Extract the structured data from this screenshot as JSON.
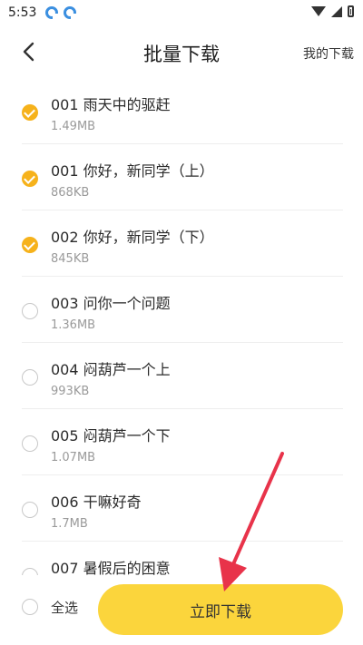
{
  "status_bar": {
    "time": "5:53"
  },
  "header": {
    "title": "批量下载",
    "my_downloads": "我的下载"
  },
  "items": [
    {
      "title": "001 雨天中的驱赶",
      "size": "1.49MB",
      "checked": true
    },
    {
      "title": "001 你好，新同学（上）",
      "size": "868KB",
      "checked": true
    },
    {
      "title": "002 你好，新同学（下）",
      "size": "845KB",
      "checked": true
    },
    {
      "title": "003 问你一个问题",
      "size": "1.36MB",
      "checked": false
    },
    {
      "title": "004 闷葫芦一个上",
      "size": "993KB",
      "checked": false
    },
    {
      "title": "005 闷葫芦一个下",
      "size": "1.07MB",
      "checked": false
    },
    {
      "title": "006 干嘛好奇",
      "size": "1.7MB",
      "checked": false
    },
    {
      "title": "007 暑假后的困意",
      "size": "",
      "checked": false
    }
  ],
  "footer": {
    "select_all": "全选",
    "download_now": "立即下载"
  },
  "colors": {
    "accent": "#f6b21b",
    "button": "#fbd53c",
    "annotation_arrow": "#e8334a"
  }
}
